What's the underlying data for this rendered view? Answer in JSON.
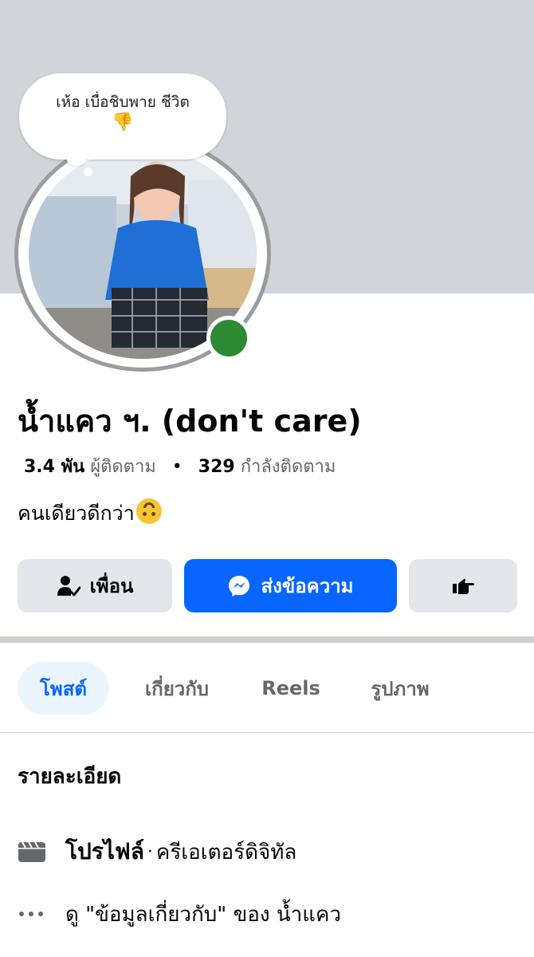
{
  "note": {
    "text": "เห้อ เบื่อชิบพาย ชีวิต",
    "emoji": "👎"
  },
  "profile": {
    "name": "น้ำแคว ฯ. (don't care)",
    "followers_count": "3.4 พัน",
    "followers_label": "ผู้ติดตาม",
    "stats_separator": "•",
    "following_count": "329",
    "following_label": "กำลังติดตาม",
    "bio": "คนเดียวดีกว่า"
  },
  "actions": {
    "friend_label": "เพื่อน",
    "message_label": "ส่งข้อความ"
  },
  "tabs": [
    {
      "label": "โพสต์",
      "active": true
    },
    {
      "label": "เกี่ยวกับ",
      "active": false
    },
    {
      "label": "Reels",
      "active": false
    },
    {
      "label": "รูปภาพ",
      "active": false
    }
  ],
  "details": {
    "title": "รายละเอียด",
    "profile_label": "โปรไฟล์",
    "profile_separator": "·",
    "profile_category": "ครีเอเตอร์ดิจิทัล",
    "about_link": "ดู \"ข้อมูลเกี่ยวกับ\" ของ น้ำแคว"
  },
  "colors": {
    "accent": "#0866ff",
    "online": "#2c8a33",
    "cover": "#d1d4d9",
    "button_gray": "#e4e6eb"
  }
}
